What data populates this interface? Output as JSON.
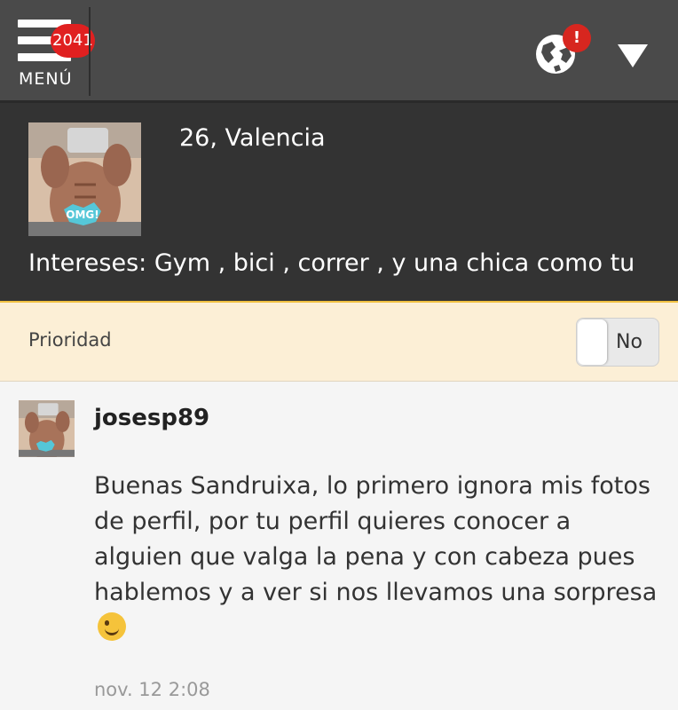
{
  "header": {
    "menu_label": "MENÚ",
    "menu_badge_count": "2041",
    "notification_badge": "!"
  },
  "profile": {
    "age_city": "26, Valencia",
    "interests": "Intereses: Gym , bici , correr , y una chica como tu",
    "photo_sticker": "OMG!"
  },
  "priority": {
    "label": "Prioridad",
    "toggle_value": "No"
  },
  "message": {
    "username": "josesp89",
    "body": "Buenas Sandruixa, lo primero ignora mis fotos de perfil, por tu perfil quieres conocer a alguien que valga la pena y con cabeza pues hablemos y a ver si nos llevamos una sorpresa",
    "emoji": "winking-face-icon",
    "timestamp": "nov. 12 2:08"
  },
  "colors": {
    "topbar": "#4a4a4a",
    "profile_bg": "#333333",
    "priority_bg": "#fcefd6",
    "badge_red": "#e02020",
    "message_bg": "#f5f5f5"
  }
}
